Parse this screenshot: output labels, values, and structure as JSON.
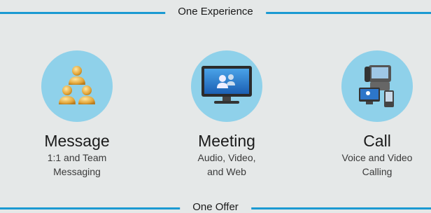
{
  "banner": {
    "top_label": "One Experience",
    "bottom_label": "One Offer"
  },
  "colors": {
    "accent_bar": "#1b9ad2",
    "circle": "#8fd1ea",
    "panel": "#e5e8e8"
  },
  "offerings": [
    {
      "icon": "people-group-icon",
      "title": "Message",
      "line1": "1:1 and Team",
      "line2": "Messaging"
    },
    {
      "icon": "video-display-icon",
      "title": "Meeting",
      "line1": "Audio, Video,",
      "line2": "and Web"
    },
    {
      "icon": "devices-phone-icon",
      "title": "Call",
      "line1": "Voice and Video",
      "line2": "Calling"
    }
  ]
}
